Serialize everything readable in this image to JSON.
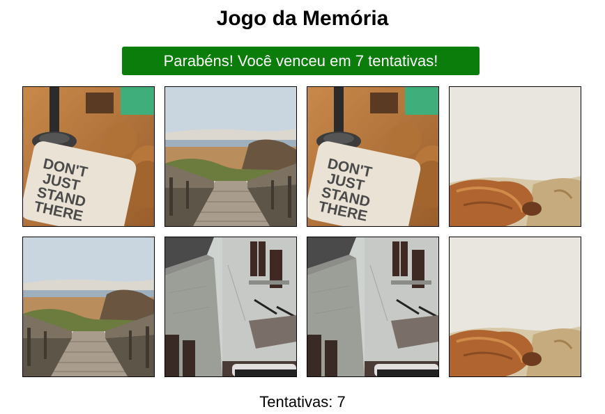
{
  "title": "Jogo da Memória",
  "banner": {
    "message": "Parabéns! Você venceu em 7 tentativas!",
    "color": "#0a7d0a"
  },
  "cards": [
    {
      "image": "coaster-photo",
      "matched": true
    },
    {
      "image": "boardwalk-photo",
      "matched": true
    },
    {
      "image": "coaster-photo",
      "matched": true
    },
    {
      "image": "highland-cow-photo",
      "matched": true
    },
    {
      "image": "boardwalk-photo",
      "matched": true
    },
    {
      "image": "old-building-photo",
      "matched": true
    },
    {
      "image": "old-building-photo",
      "matched": true
    },
    {
      "image": "highland-cow-photo",
      "matched": true
    }
  ],
  "coaster_text": [
    "DON'T",
    "JUST",
    "STAND",
    "THERE"
  ],
  "counter": {
    "label": "Tentativas:",
    "value": 7,
    "text": "Tentativas: 7"
  }
}
